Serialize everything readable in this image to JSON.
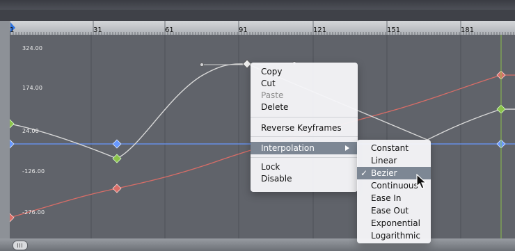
{
  "ruler": {
    "labels": [
      "1",
      "31",
      "61",
      "91",
      "121",
      "151",
      "181"
    ]
  },
  "yaxis": {
    "labels": [
      "324.00",
      "174.00",
      "24.00",
      "-126.00",
      "-276.00"
    ]
  },
  "context_menu": {
    "items": [
      {
        "label": "Copy",
        "enabled": true
      },
      {
        "label": "Cut",
        "enabled": true
      },
      {
        "label": "Paste",
        "enabled": false
      },
      {
        "label": "Delete",
        "enabled": true
      },
      {
        "label": "Reverse Keyframes",
        "enabled": true
      },
      {
        "label": "Interpolation",
        "enabled": true,
        "submenu": true,
        "highlighted": true
      },
      {
        "label": "Lock",
        "enabled": true
      },
      {
        "label": "Disable",
        "enabled": true
      }
    ]
  },
  "interpolation_submenu": {
    "items": [
      {
        "label": "Constant",
        "checked": false,
        "highlighted": false
      },
      {
        "label": "Linear",
        "checked": false,
        "highlighted": false
      },
      {
        "label": "Bezier",
        "checked": true,
        "highlighted": true
      },
      {
        "label": "Continuous",
        "checked": false,
        "highlighted": false
      },
      {
        "label": "Ease In",
        "checked": false,
        "highlighted": false
      },
      {
        "label": "Ease Out",
        "checked": false,
        "highlighted": false
      },
      {
        "label": "Exponential",
        "checked": false,
        "highlighted": false
      },
      {
        "label": "Logarithmic",
        "checked": false,
        "highlighted": false
      }
    ]
  },
  "colors": {
    "graph_background": "#60636a",
    "grid_line": "#4e5158",
    "curve_white": "#d8d8d8",
    "curve_red": "#d86d67",
    "curve_blue": "#6798ff",
    "menu_highlight": "#7d8794",
    "playhead_green": "#8bc24a"
  }
}
